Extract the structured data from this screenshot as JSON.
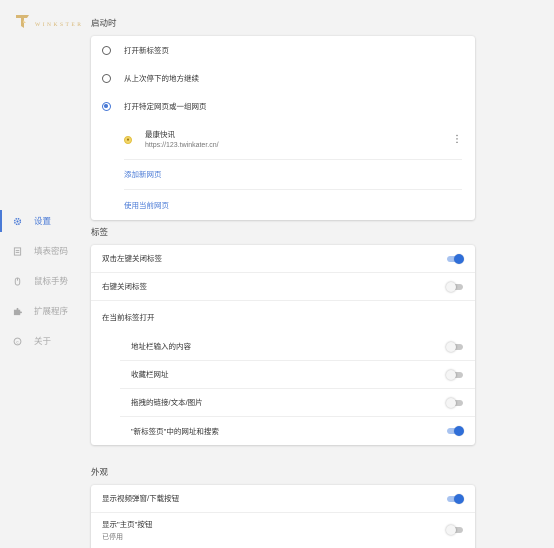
{
  "brand": {
    "logo_text": "WINKSTER",
    "accent": "#d8b774"
  },
  "sidebar": {
    "items": [
      {
        "label": "设置",
        "icon": "gear-icon",
        "active": true
      },
      {
        "label": "填表密码",
        "icon": "form-icon",
        "active": false
      },
      {
        "label": "鼠标手势",
        "icon": "mouse-icon",
        "active": false
      },
      {
        "label": "扩展程序",
        "icon": "puzzle-icon",
        "active": false
      },
      {
        "label": "关于",
        "icon": "info-icon",
        "active": false
      }
    ]
  },
  "startup": {
    "title": "启动时",
    "options": [
      {
        "label": "打开新标签页",
        "checked": false
      },
      {
        "label": "从上次停下的地方继续",
        "checked": false
      },
      {
        "label": "打开特定网页或一组网页",
        "checked": true
      }
    ],
    "page": {
      "name": "最康快讯",
      "url": "https://123.twinkater.cn/"
    },
    "add_page": "添加新网页",
    "use_current": "使用当前网页"
  },
  "tabs": {
    "title": "标签",
    "double_click_close": {
      "label": "双击左键关闭标签",
      "on": true
    },
    "right_click_close": {
      "label": "右键关闭标签",
      "on": false
    },
    "open_in_current": "在当前标签打开",
    "sub": [
      {
        "label": "地址栏输入的内容",
        "on": false
      },
      {
        "label": "收藏栏网址",
        "on": false
      },
      {
        "label": "拖拽的链接/文本/图片",
        "on": false
      },
      {
        "label": "\"新标签页\"中的网址和搜索",
        "on": true
      }
    ]
  },
  "appearance": {
    "title": "外观",
    "video_button": {
      "label": "显示视频弹窗/下载按钮",
      "on": true
    },
    "home_button": {
      "label": "显示\"主页\"按钮",
      "sublabel": "已停用",
      "on": false
    }
  },
  "colors": {
    "accent": "#4a7ad6",
    "toggle_on": "#2f6ed8"
  }
}
